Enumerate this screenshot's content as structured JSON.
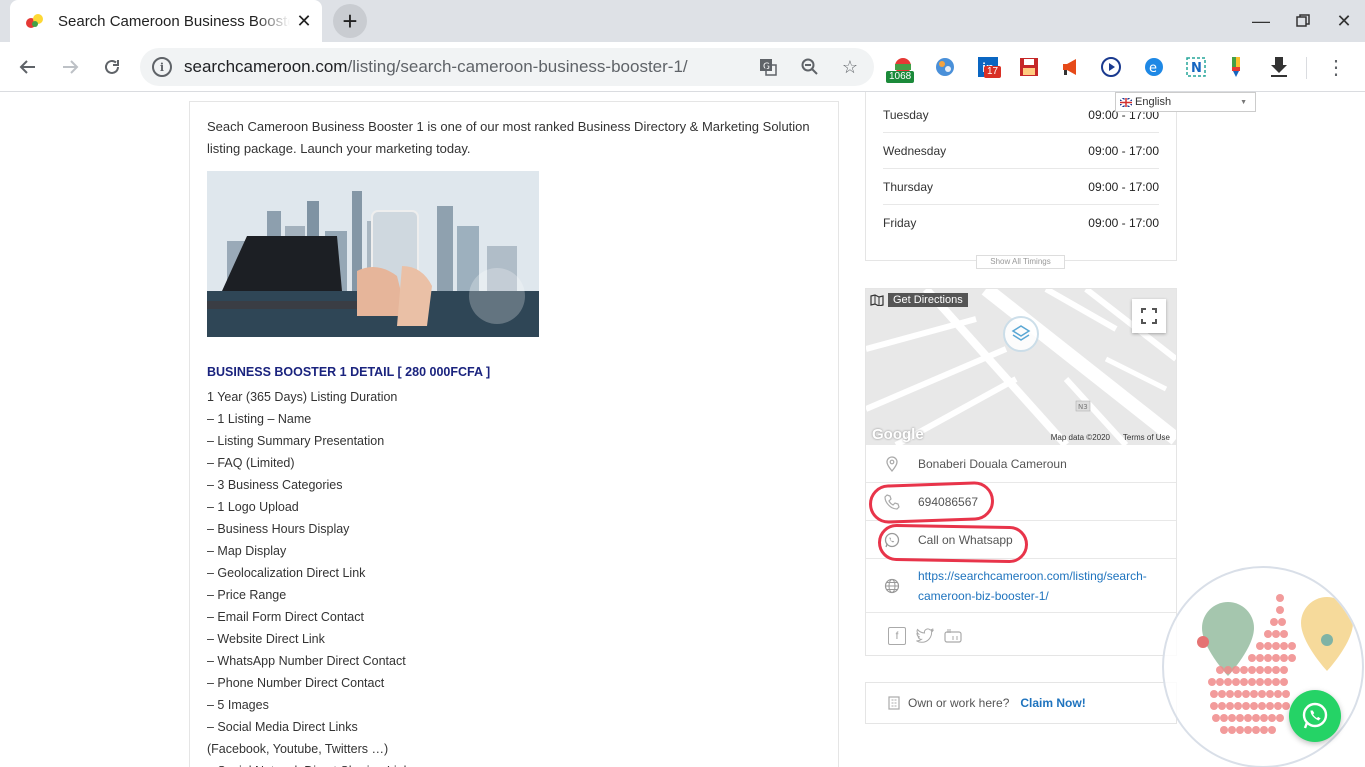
{
  "browser": {
    "tab_title": "Search Cameroon Business Booster 1",
    "new_tab_label": "+",
    "url_host": "searchcameroon.com",
    "url_path": "/listing/search-cameroon-business-booster-1/",
    "extensions": {
      "badge_1068": "1068",
      "badge_17": "17",
      "linkedin": "in"
    }
  },
  "translate": {
    "selected": "English"
  },
  "listing": {
    "intro": "Seach Cameroon Business Booster 1 is one of our most ranked Business Directory & Marketing Solution listing package. Launch your marketing today.",
    "detail_heading": "BUSINESS BOOSTER 1 DETAIL [ 280 000FCFA ]",
    "features": [
      "1 Year (365 Days) Listing Duration",
      "– 1 Listing – Name",
      "– Listing Summary Presentation",
      "– FAQ (Limited)",
      "– 3 Business Categories",
      "– 1 Logo Upload",
      "– Business Hours Display",
      "– Map Display",
      "– Geolocalization Direct Link",
      "– Price Range",
      "– Email Form Direct Contact",
      "– Website Direct Link",
      "– WhatsApp Number Direct Contact",
      "– Phone Number Direct Contact",
      "– 5 Images",
      "– Social Media Direct Links",
      "(Facebook, Youtube, Twitters …)",
      "– Social Network Direct Sharing Link"
    ]
  },
  "hours": {
    "rows": [
      {
        "day": "Tuesday",
        "time": "09:00 - 17:00"
      },
      {
        "day": "Wednesday",
        "time": "09:00 - 17:00"
      },
      {
        "day": "Thursday",
        "time": "09:00 - 17:00"
      },
      {
        "day": "Friday",
        "time": "09:00 - 17:00"
      }
    ],
    "show_all": "Show All Timings"
  },
  "map": {
    "get_directions": "Get Directions",
    "google": "Google",
    "map_data": "Map data ©2020",
    "terms": "Terms of Use",
    "road_label": "N3"
  },
  "contact": {
    "address": "Bonaberi Douala Cameroun",
    "phone": "694086567",
    "whatsapp": "Call on Whatsapp",
    "website": "https://searchcameroon.com/listing/search-cameroon-biz-booster-1/"
  },
  "claim": {
    "text": "Own or work here?",
    "link": "Claim Now!"
  },
  "colors": {
    "accent": "#1e73be",
    "heading": "#1a237e",
    "highlight": "#e8344a",
    "whatsapp": "#25d366"
  }
}
